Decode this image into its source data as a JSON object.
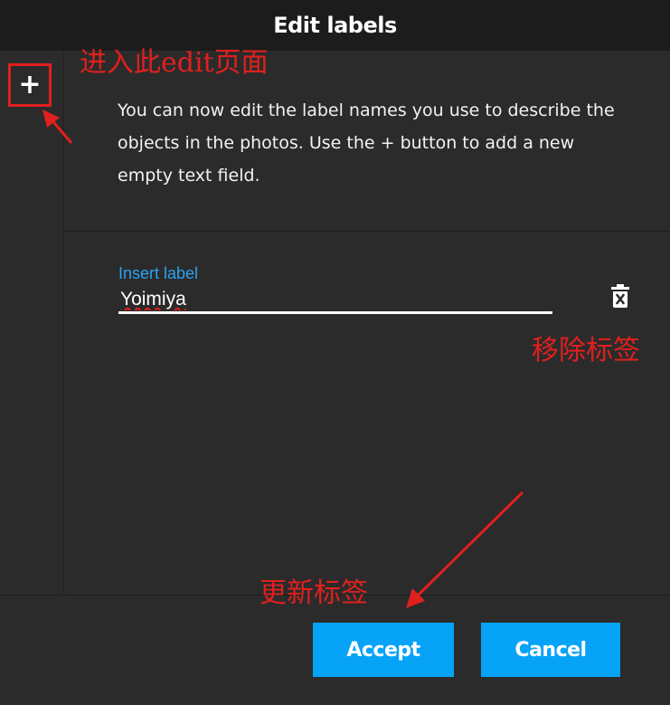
{
  "header": {
    "title": "Edit labels"
  },
  "sidebar": {
    "add_button_label": "+"
  },
  "main": {
    "description": "You can now edit the label names you use to describe the objects in the photos. Use the + button to add a new empty text field.",
    "field": {
      "label": "Insert label",
      "value": "Yoimiya"
    }
  },
  "footer": {
    "accept_label": "Accept",
    "cancel_label": "Cancel"
  },
  "annotations": {
    "add_note": "进入此edit页面",
    "remove_note": "移除标签",
    "update_note": "更新标签"
  },
  "colors": {
    "accent": "#06a3f7",
    "field_label": "#2aa3f0",
    "annotation": "#e0201e",
    "background": "#2b2b2b",
    "titlebar": "#1c1c1c"
  },
  "icons": {
    "add": "plus-icon",
    "delete": "trash-x-icon"
  }
}
